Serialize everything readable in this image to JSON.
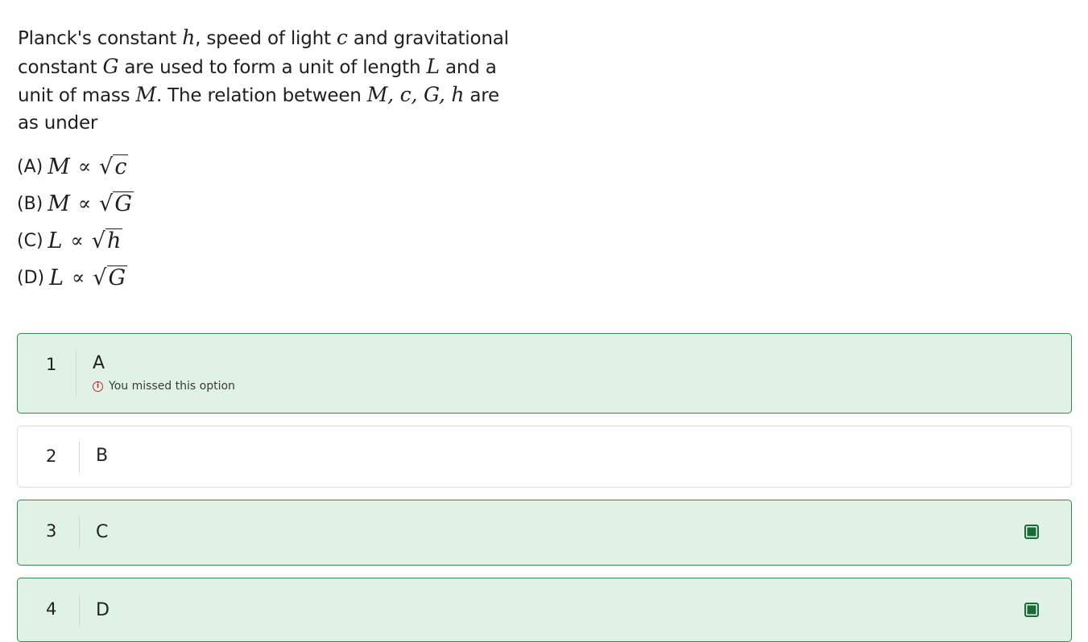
{
  "question": {
    "part1": "Planck's constant ",
    "sym_h": "h",
    "part2": ", speed of light ",
    "sym_c": "c",
    "part3": " and gravitational constant ",
    "sym_G": "G",
    "part4": " are used to form a unit of length ",
    "sym_L": "L",
    "part5": " and a unit of mass ",
    "sym_M": "M",
    "part6": ". The relation between ",
    "sym_list": "M, c, G, h",
    "part7": " are as under"
  },
  "choices": [
    {
      "label": "(A)",
      "lhs": "M",
      "prop": "∝",
      "root_sym": "√",
      "radicand": "c"
    },
    {
      "label": "(B)",
      "lhs": "M",
      "prop": "∝",
      "root_sym": "√",
      "radicand": "G"
    },
    {
      "label": "(C)",
      "lhs": "L",
      "prop": "∝",
      "root_sym": "√",
      "radicand": "h"
    },
    {
      "label": "(D)",
      "lhs": "L",
      "prop": "∝",
      "root_sym": "√",
      "radicand": "G"
    }
  ],
  "options": [
    {
      "number": "1",
      "letter": "A",
      "selected": true,
      "note": "You missed this option",
      "note_icon": "info-icon",
      "checked": false
    },
    {
      "number": "2",
      "letter": "B",
      "selected": false,
      "note": "",
      "checked": false
    },
    {
      "number": "3",
      "letter": "C",
      "selected": true,
      "note": "",
      "checked": true
    },
    {
      "number": "4",
      "letter": "D",
      "selected": true,
      "note": "",
      "checked": true
    }
  ],
  "colors": {
    "selected_bg": "#e0f2e6",
    "selected_border": "#2e8b4a",
    "checkbox": "#1b6b39",
    "warning": "#c62828"
  }
}
